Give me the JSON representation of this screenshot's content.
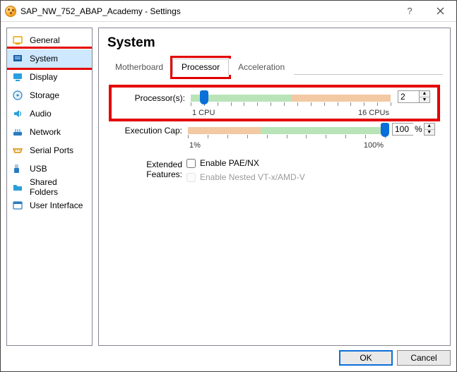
{
  "window": {
    "title": "SAP_NW_752_ABAP_Academy - Settings",
    "help": "?",
    "close": "×"
  },
  "sidebar": {
    "items": [
      {
        "label": "General"
      },
      {
        "label": "System"
      },
      {
        "label": "Display"
      },
      {
        "label": "Storage"
      },
      {
        "label": "Audio"
      },
      {
        "label": "Network"
      },
      {
        "label": "Serial Ports"
      },
      {
        "label": "USB"
      },
      {
        "label": "Shared Folders"
      },
      {
        "label": "User Interface"
      }
    ],
    "selected_index": 1
  },
  "main": {
    "title": "System",
    "tabs": [
      {
        "label": "Motherboard"
      },
      {
        "label": "Processor"
      },
      {
        "label": "Acceleration"
      }
    ],
    "active_tab": 1,
    "processor": {
      "label": "Processor(s):",
      "value": "2",
      "min_label": "1 CPU",
      "max_label": "16 CPUs",
      "min": 1,
      "max": 16,
      "green_end_frac": 0.5,
      "thumb_frac": 0.067
    },
    "exec": {
      "label": "Execution Cap:",
      "value": "100",
      "unit": "%",
      "min_label": "1%",
      "max_label": "100%",
      "green_start_frac": 0.37,
      "thumb_frac": 1.0
    },
    "features": {
      "label": "Extended Features:",
      "pae": "Enable PAE/NX",
      "pae_checked": false,
      "nested": "Enable Nested VT-x/AMD-V",
      "nested_enabled": false,
      "nested_checked": false
    }
  },
  "buttons": {
    "ok": "OK",
    "cancel": "Cancel"
  }
}
